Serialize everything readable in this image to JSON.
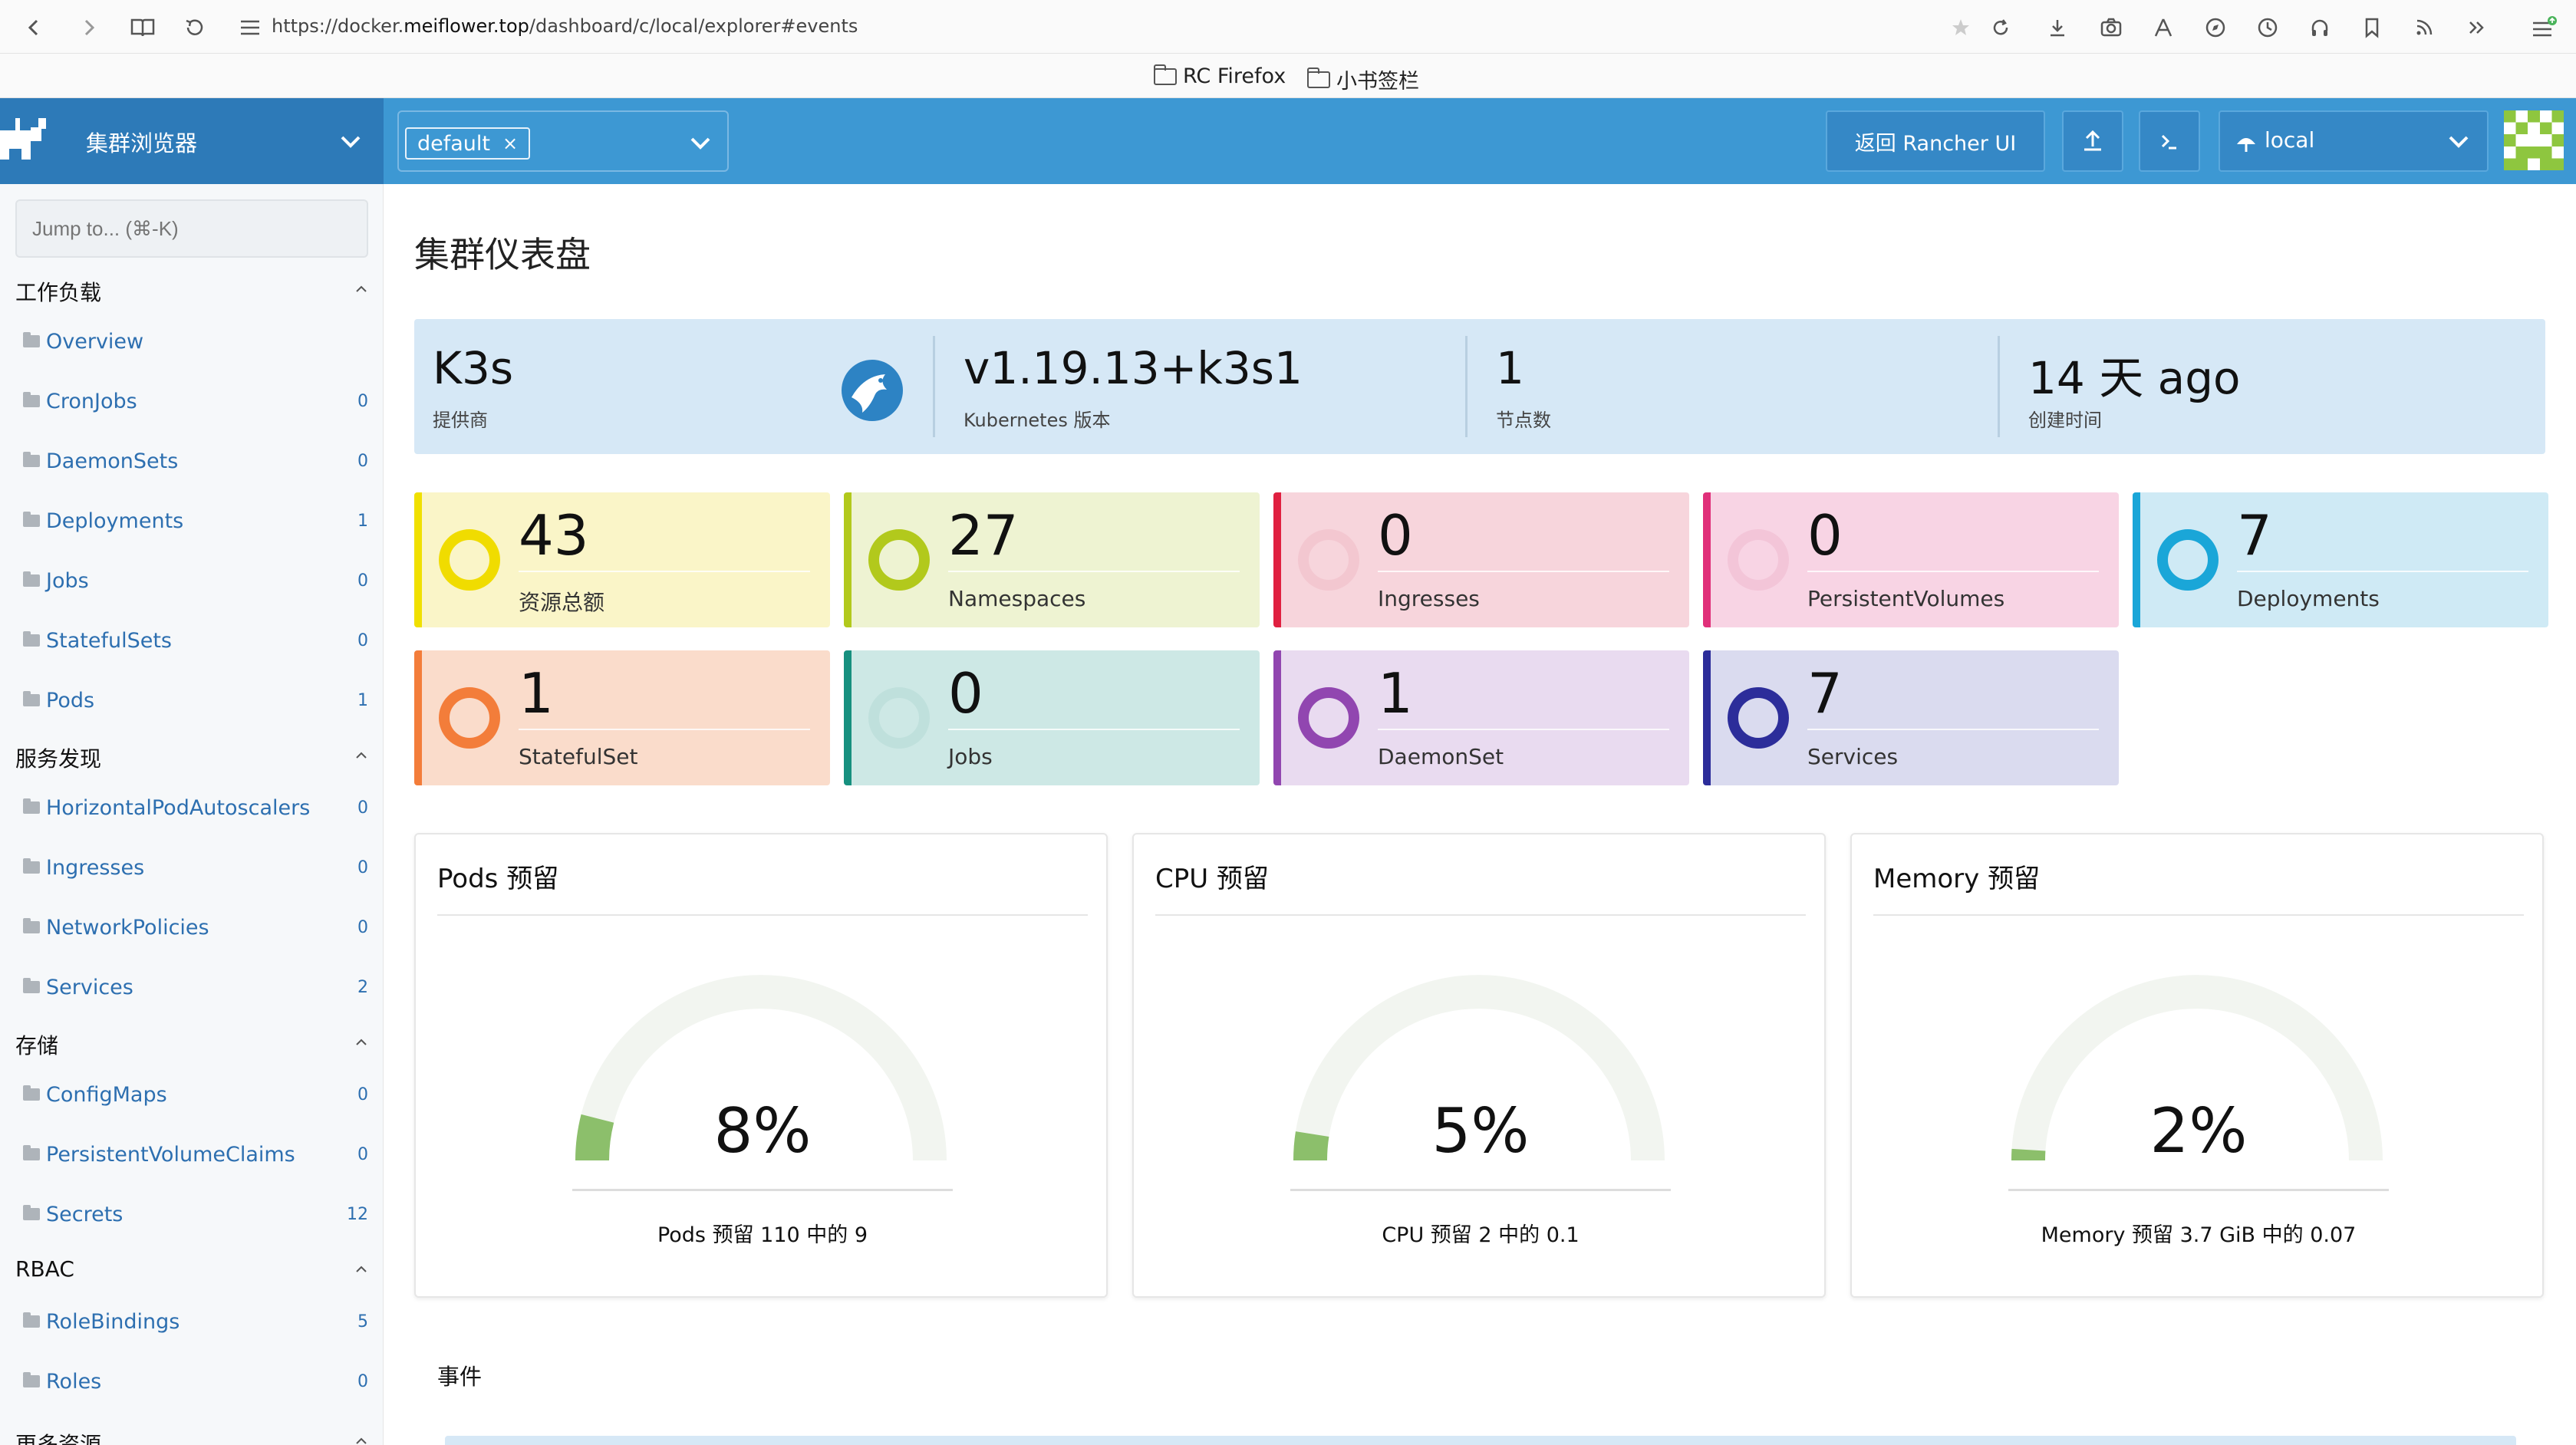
{
  "browser": {
    "url_prefix": "https://docker.",
    "url_domain": "meiflower.top",
    "url_suffix": "/dashboard/c/local/explorer#events",
    "bookmarks": [
      "RC Firefox",
      "小书签栏"
    ]
  },
  "header": {
    "product": "集群浏览器",
    "namespace_chip": "default",
    "namespace_chip_remove": "×",
    "back_button": "返回 Rancher UI",
    "cluster": "local"
  },
  "sidebar": {
    "jump_placeholder": "Jump to... (⌘-K)",
    "groups": [
      {
        "label": "工作负载",
        "items": [
          {
            "label": "Overview",
            "count": ""
          },
          {
            "label": "CronJobs",
            "count": "0"
          },
          {
            "label": "DaemonSets",
            "count": "0"
          },
          {
            "label": "Deployments",
            "count": "1"
          },
          {
            "label": "Jobs",
            "count": "0"
          },
          {
            "label": "StatefulSets",
            "count": "0"
          },
          {
            "label": "Pods",
            "count": "1"
          }
        ]
      },
      {
        "label": "服务发现",
        "items": [
          {
            "label": "HorizontalPodAutoscalers",
            "count": "0"
          },
          {
            "label": "Ingresses",
            "count": "0"
          },
          {
            "label": "NetworkPolicies",
            "count": "0"
          },
          {
            "label": "Services",
            "count": "2"
          }
        ]
      },
      {
        "label": "存储",
        "items": [
          {
            "label": "ConfigMaps",
            "count": "0"
          },
          {
            "label": "PersistentVolumeClaims",
            "count": "0"
          },
          {
            "label": "Secrets",
            "count": "12"
          }
        ]
      },
      {
        "label": "RBAC",
        "items": [
          {
            "label": "RoleBindings",
            "count": "5"
          },
          {
            "label": "Roles",
            "count": "0"
          }
        ]
      },
      {
        "label": "更多资源",
        "items": []
      }
    ]
  },
  "main": {
    "title": "集群仪表盘",
    "cluster_info": [
      {
        "value": "K3s",
        "label": "提供商"
      },
      {
        "value": "v1.19.13+k3s1",
        "label": "Kubernetes 版本"
      },
      {
        "value": "1",
        "label": "节点数"
      },
      {
        "value": "14 天 ago",
        "label": "创建时间"
      }
    ],
    "tiles": [
      {
        "value": "43",
        "label": "资源总额",
        "color": "#f0e000",
        "bg": "#faf5c8",
        "ring": "#f0dc00"
      },
      {
        "value": "27",
        "label": "Namespaces",
        "color": "#b2c91c",
        "bg": "#eef3d2",
        "ring": "#b2c91c"
      },
      {
        "value": "0",
        "label": "Ingresses",
        "color": "#e02040",
        "bg": "#f7d5dc",
        "ring": "#f3c7d0"
      },
      {
        "value": "0",
        "label": "PersistentVolumes",
        "color": "#e0307a",
        "bg": "#f8d4e4",
        "ring": "#f3c5d8"
      },
      {
        "value": "7",
        "label": "Deployments",
        "color": "#1aa6d8",
        "bg": "#cfeaf5",
        "ring": "#1aa6d8"
      },
      {
        "value": "1",
        "label": "StatefulSet",
        "color": "#f37d3a",
        "bg": "#fadccb",
        "ring": "#f37d3a"
      },
      {
        "value": "0",
        "label": "Jobs",
        "color": "#17907f",
        "bg": "#cde8e5",
        "ring": "#bfe0dc"
      },
      {
        "value": "1",
        "label": "DaemonSet",
        "color": "#9146b0",
        "bg": "#e9dbf0",
        "ring": "#9146b0"
      },
      {
        "value": "7",
        "label": "Services",
        "color": "#2c2d9a",
        "bg": "#dadbef",
        "ring": "#2c2d9a"
      }
    ],
    "gauges": [
      {
        "title": "Pods 预留",
        "percent": "8%",
        "fraction": 0.08,
        "caption": "Pods 预留 110 中的 9"
      },
      {
        "title": "CPU 预留",
        "percent": "5%",
        "fraction": 0.05,
        "caption": "CPU 预留 2 中的 0.1"
      },
      {
        "title": "Memory 预留",
        "percent": "2%",
        "fraction": 0.02,
        "caption": "Memory 预留 3.7 GiB 中的 0.07"
      }
    ],
    "events_label": "事件"
  }
}
